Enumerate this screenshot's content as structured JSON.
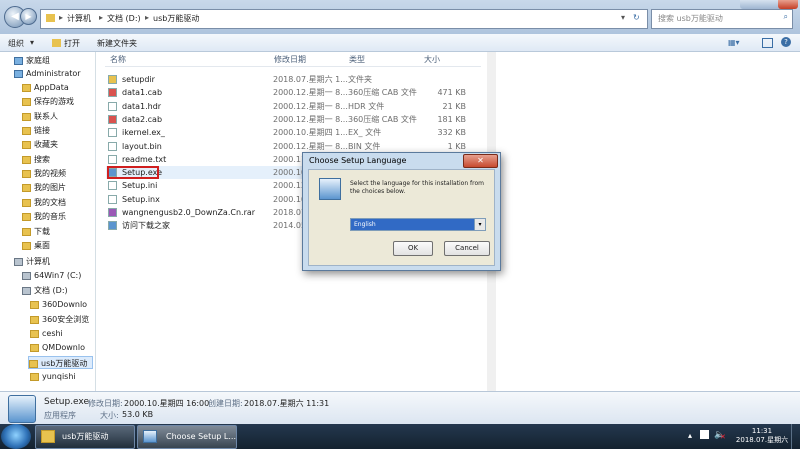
{
  "address": {
    "crumbs": [
      "计算机",
      "文档 (D:)",
      "usb万能驱动"
    ],
    "search_placeholder": "搜索 usb万能驱动"
  },
  "toolbar": {
    "organize": "组织",
    "open": "打开",
    "new_folder": "新建文件夹"
  },
  "sidebar": {
    "items": [
      {
        "label": "家庭组",
        "icon": "homegroup-icon"
      },
      {
        "label": "Administrator",
        "icon": "user-icon"
      },
      {
        "label": "AppData",
        "icon": "folder-icon"
      },
      {
        "label": "保存的游戏",
        "icon": "folder-icon"
      },
      {
        "label": "联系人",
        "icon": "folder-icon"
      },
      {
        "label": "链接",
        "icon": "folder-icon"
      },
      {
        "label": "收藏夹",
        "icon": "folder-icon"
      },
      {
        "label": "搜索",
        "icon": "folder-icon"
      },
      {
        "label": "我的视频",
        "icon": "folder-icon"
      },
      {
        "label": "我的图片",
        "icon": "folder-icon"
      },
      {
        "label": "我的文档",
        "icon": "folder-icon"
      },
      {
        "label": "我的音乐",
        "icon": "folder-icon"
      },
      {
        "label": "下载",
        "icon": "folder-icon"
      },
      {
        "label": "桌面",
        "icon": "folder-icon"
      },
      {
        "label": "计算机",
        "icon": "computer-icon"
      },
      {
        "label": "64Win7  (C:)",
        "icon": "drive-icon"
      },
      {
        "label": "文档 (D:)",
        "icon": "drive-icon"
      },
      {
        "label": "360Downlo",
        "icon": "folder-icon"
      },
      {
        "label": "360安全浏览",
        "icon": "folder-icon"
      },
      {
        "label": "ceshi",
        "icon": "folder-icon"
      },
      {
        "label": "QMDownlo",
        "icon": "folder-icon"
      },
      {
        "label": "usb万能驱动",
        "icon": "folder-icon"
      },
      {
        "label": "yunqishi",
        "icon": "folder-icon"
      }
    ]
  },
  "columns": {
    "name": "名称",
    "date": "修改日期",
    "type": "类型",
    "size": "大小"
  },
  "files": [
    {
      "name": "setupdir",
      "date": "2018.07.星期六 1...",
      "type": "文件夹",
      "size": ""
    },
    {
      "name": "data1.cab",
      "date": "2000.12.星期一 8...",
      "type": "360压缩 CAB 文件",
      "size": "471 KB"
    },
    {
      "name": "data1.hdr",
      "date": "2000.12.星期一 8...",
      "type": "HDR 文件",
      "size": "21 KB"
    },
    {
      "name": "data2.cab",
      "date": "2000.12.星期一 8...",
      "type": "360压缩 CAB 文件",
      "size": "181 KB"
    },
    {
      "name": "ikernel.ex_",
      "date": "2000.10.星期四 1...",
      "type": "EX_ 文件",
      "size": "332 KB"
    },
    {
      "name": "layout.bin",
      "date": "2000.12.星期一 8...",
      "type": "BIN 文件",
      "size": "1 KB"
    },
    {
      "name": "readme.txt",
      "date": "2000.11",
      "type": "",
      "size": ""
    },
    {
      "name": "Setup.exe",
      "date": "2000.10",
      "type": "",
      "size": ""
    },
    {
      "name": "Setup.ini",
      "date": "2000.12",
      "type": "",
      "size": ""
    },
    {
      "name": "Setup.inx",
      "date": "2000.10",
      "type": "",
      "size": ""
    },
    {
      "name": "wangnengusb2.0_DownZa.Cn.rar",
      "date": "2018.07",
      "type": "",
      "size": ""
    },
    {
      "name": "访问下载之家",
      "date": "2014.05",
      "type": "",
      "size": ""
    }
  ],
  "details": {
    "name": "Setup.exe",
    "modified_label": "修改日期:",
    "modified": "2000.10.星期四 16:00",
    "created_label": "创建日期:",
    "created": "2018.07.星期六 11:31",
    "type": "应用程序",
    "size_label": "大小:",
    "size": "53.0 KB"
  },
  "dialog": {
    "title": "Choose Setup Language",
    "message": "Select the language for this installation from the choices below.",
    "selected_language": "English",
    "ok": "OK",
    "cancel": "Cancel"
  },
  "taskbar": {
    "tasks": [
      "usb万能驱动",
      "Choose Setup L..."
    ],
    "time": "11:31",
    "date": "2018.07.星期六"
  },
  "colors": {
    "accent": "#3b78c4",
    "selection_outline": "#d01f1f",
    "dialog_frame": "#c9dcee"
  }
}
